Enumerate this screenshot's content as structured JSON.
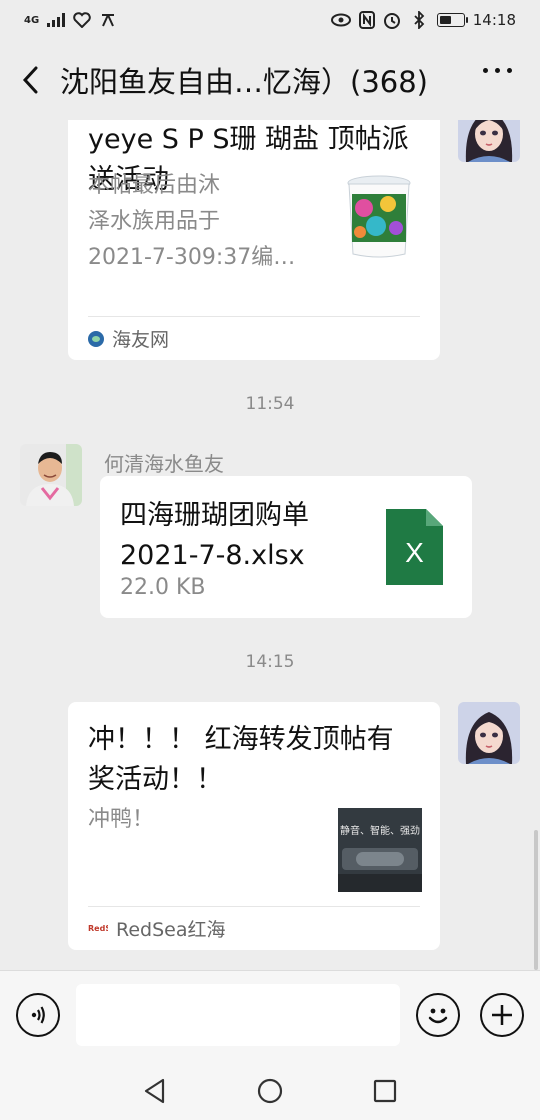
{
  "status_bar": {
    "network": "4G",
    "time": "14:18"
  },
  "header": {
    "title": "沈阳鱼友自由…忆海）(368)"
  },
  "messages": [
    {
      "type": "link-card",
      "title": "yeye S P S珊 瑚盐 顶帖派送活动",
      "description_lines": [
        "本帖最后由沐",
        "泽水族用品于",
        "2021-7-309:37编…"
      ],
      "source": "海友网"
    },
    {
      "type": "timestamp",
      "text": "11:54"
    },
    {
      "type": "file-card",
      "sender": "何清海水鱼友",
      "file_name_lines": [
        "四海珊瑚团购单",
        "2021-7-8.xlsx"
      ],
      "file_size": "22.0 KB",
      "file_icon_text": "X"
    },
    {
      "type": "timestamp",
      "text": "14:15"
    },
    {
      "type": "link-card",
      "title_lines": [
        "冲！！！ 红海转发顶帖有",
        "奖活动！！"
      ],
      "description": "冲鸭！",
      "thumbnail_text": "静音、智能、强劲",
      "source": "RedSea红海",
      "source_logo": "RedSea"
    }
  ],
  "input": {
    "placeholder": ""
  },
  "colors": {
    "background": "#ededed",
    "card": "#ffffff",
    "excel_green": "#1f7a44",
    "muted_text": "#8a8a8a"
  }
}
